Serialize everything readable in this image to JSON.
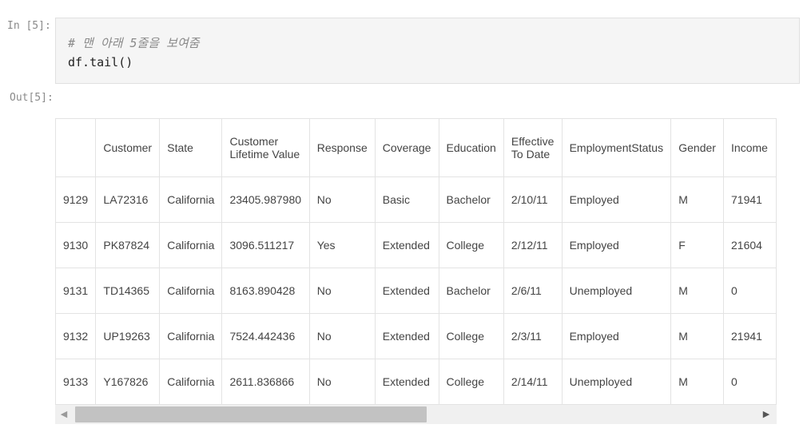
{
  "input_prompt": "In [5]:",
  "output_prompt": "Out[5]:",
  "code": {
    "comment": "# 맨 아래 5줄을 보여줌",
    "line": "df.tail()"
  },
  "table": {
    "columns": [
      "",
      "Customer",
      "State",
      "Customer Lifetime Value",
      "Response",
      "Coverage",
      "Education",
      "Effective To Date",
      "EmploymentStatus",
      "Gender",
      "Income"
    ],
    "rows": [
      [
        "9129",
        "LA72316",
        "California",
        "23405.987980",
        "No",
        "Basic",
        "Bachelor",
        "2/10/11",
        "Employed",
        "M",
        "71941"
      ],
      [
        "9130",
        "PK87824",
        "California",
        "3096.511217",
        "Yes",
        "Extended",
        "College",
        "2/12/11",
        "Employed",
        "F",
        "21604"
      ],
      [
        "9131",
        "TD14365",
        "California",
        "8163.890428",
        "No",
        "Extended",
        "Bachelor",
        "2/6/11",
        "Unemployed",
        "M",
        "0"
      ],
      [
        "9132",
        "UP19263",
        "California",
        "7524.442436",
        "No",
        "Extended",
        "College",
        "2/3/11",
        "Employed",
        "M",
        "21941"
      ],
      [
        "9133",
        "Y167826",
        "California",
        "2611.836866",
        "No",
        "Extended",
        "College",
        "2/14/11",
        "Unemployed",
        "M",
        "0"
      ]
    ]
  },
  "scrollbar": {
    "left_icon": "scroll-left-arrow-icon",
    "right_icon": "scroll-right-arrow-icon"
  }
}
